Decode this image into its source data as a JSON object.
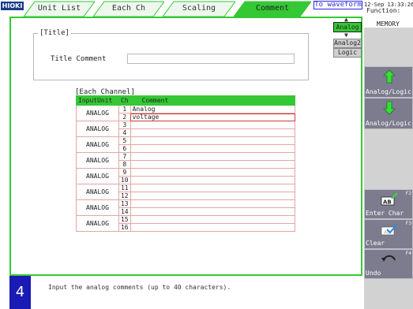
{
  "brand": "HIOKI",
  "tabs": [
    {
      "label": "Unit List",
      "active": false
    },
    {
      "label": "Each Ch",
      "active": false
    },
    {
      "label": "Scaling",
      "active": false
    },
    {
      "label": "Comment",
      "active": true
    }
  ],
  "to_waveform": "To waveform",
  "datetime": "12-Sep 13:33:26",
  "function": {
    "label": "Function:",
    "value": "MEMORY"
  },
  "title_group": {
    "legend": "[Title]",
    "label": "Title Comment",
    "value": ""
  },
  "selector": {
    "up": "▲",
    "down": "▼",
    "analog": "Analog",
    "analog2": "Analog2",
    "logic": "Logic"
  },
  "channel_table": {
    "caption": "[Each Channel]",
    "headers": [
      "InputUnit",
      "Ch",
      "Comment"
    ],
    "rows": [
      {
        "unit": "ANALOG",
        "channels": [
          {
            "ch": "1",
            "comment": "Analog"
          },
          {
            "ch": "2",
            "comment": "voltage"
          }
        ]
      },
      {
        "unit": "ANALOG",
        "channels": [
          {
            "ch": "3",
            "comment": ""
          },
          {
            "ch": "4",
            "comment": ""
          }
        ]
      },
      {
        "unit": "ANALOG",
        "channels": [
          {
            "ch": "5",
            "comment": ""
          },
          {
            "ch": "6",
            "comment": ""
          }
        ]
      },
      {
        "unit": "ANALOG",
        "channels": [
          {
            "ch": "7",
            "comment": ""
          },
          {
            "ch": "8",
            "comment": ""
          }
        ]
      },
      {
        "unit": "ANALOG",
        "channels": [
          {
            "ch": "9",
            "comment": ""
          },
          {
            "ch": "10",
            "comment": ""
          }
        ]
      },
      {
        "unit": "ANALOG",
        "channels": [
          {
            "ch": "11",
            "comment": ""
          },
          {
            "ch": "12",
            "comment": ""
          }
        ]
      },
      {
        "unit": "ANALOG",
        "channels": [
          {
            "ch": "13",
            "comment": ""
          },
          {
            "ch": "14",
            "comment": ""
          }
        ]
      },
      {
        "unit": "ANALOG",
        "channels": [
          {
            "ch": "15",
            "comment": ""
          },
          {
            "ch": "16",
            "comment": ""
          }
        ]
      }
    ]
  },
  "side_buttons": [
    {
      "label": "Analog/Logic",
      "icon": "arrow-up-icon",
      "key": ""
    },
    {
      "label": "Analog/Logic",
      "icon": "arrow-down-icon",
      "key": ""
    },
    {
      "label": "Enter Char",
      "icon": "enter-char-icon",
      "key": "F2"
    },
    {
      "label": "Clear",
      "icon": "clear-icon",
      "key": "F3"
    },
    {
      "label": "Undo",
      "icon": "undo-icon",
      "key": "F4"
    }
  ],
  "status": {
    "mode_number": "4",
    "message": "Input the analog comments (up to 40 characters)."
  },
  "colors": {
    "accent_green": "#35c835",
    "brand_blue": "#1a3a8c",
    "mode_blue": "#1a1ab4",
    "link_blue": "#2a2ae0",
    "cursor_red": "#d23a3a"
  }
}
